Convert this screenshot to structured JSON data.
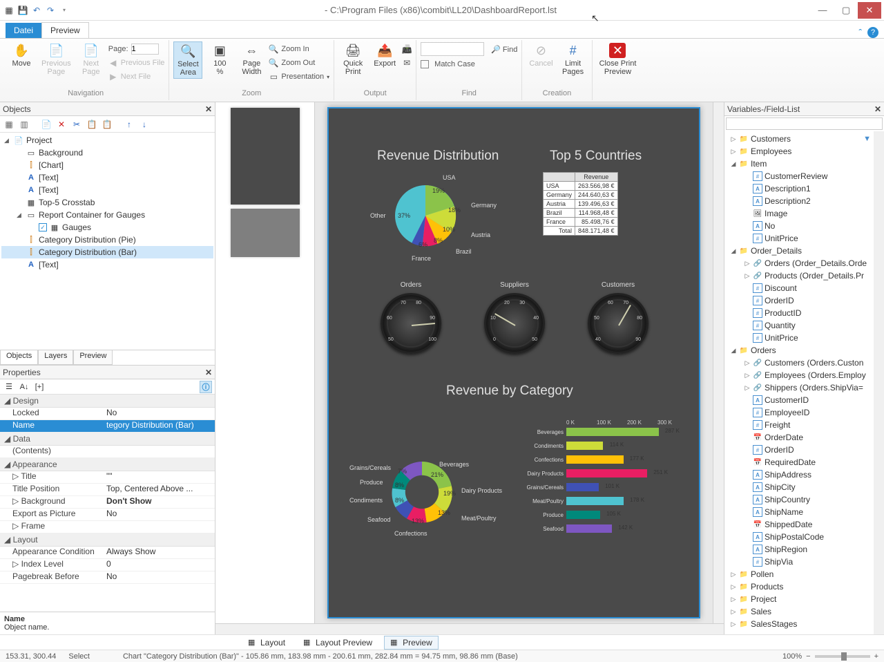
{
  "title": "- C:\\Program Files (x86)\\combit\\LL20\\DashboardReport.lst",
  "tabs": {
    "datei": "Datei",
    "preview": "Preview"
  },
  "ribbon": {
    "nav": {
      "move": "Move",
      "prevPage": "Previous\nPage",
      "nextPage": "Next\nPage",
      "page": "Page:",
      "pageVal": "1",
      "prevFile": "Previous File",
      "nextFile": "Next File",
      "group": "Navigation"
    },
    "zoom": {
      "selectArea": "Select\nArea",
      "pct": "100\n%",
      "pageWidth": "Page\nWidth",
      "zoomIn": "Zoom In",
      "zoomOut": "Zoom Out",
      "presentation": "Presentation",
      "group": "Zoom"
    },
    "output": {
      "quickPrint": "Quick\nPrint",
      "export": "Export",
      "group": "Output"
    },
    "find": {
      "find": "Find",
      "matchCase": "Match Case",
      "group": "Find"
    },
    "creation": {
      "cancel": "Cancel",
      "limitPages": "Limit\nPages",
      "group": "Creation"
    },
    "close": {
      "closePrint": "Close Print\nPreview"
    }
  },
  "objects": {
    "title": "Objects",
    "root": "Project",
    "items": [
      "Background",
      "[Chart]",
      "[Text]",
      "[Text]",
      "Top-5 Crosstab",
      "Report Container for Gauges",
      "Gauges",
      "Category Distribution (Pie)",
      "Category Distribution (Bar)",
      "[Text]"
    ],
    "tabs": [
      "Objects",
      "Layers",
      "Preview"
    ]
  },
  "props": {
    "title": "Properties",
    "cats": {
      "design": "Design",
      "data": "Data",
      "appearance": "Appearance",
      "layout": "Layout"
    },
    "rows": {
      "locked": {
        "k": "Locked",
        "v": "No"
      },
      "name": {
        "k": "Name",
        "v": "tegory Distribution (Bar)"
      },
      "contents": {
        "k": "(Contents)",
        "v": ""
      },
      "titleK": {
        "k": "Title",
        "v": "\"\""
      },
      "titlePos": {
        "k": "Title Position",
        "v": "Top, Centered Above ..."
      },
      "background": {
        "k": "Background",
        "v": "Don't Show"
      },
      "exportPic": {
        "k": "Export as Picture",
        "v": "No"
      },
      "frame": {
        "k": "Frame",
        "v": ""
      },
      "appCond": {
        "k": "Appearance Condition",
        "v": "Always Show"
      },
      "indexLevel": {
        "k": "Index Level",
        "v": "0"
      },
      "pageBreak": {
        "k": "Pagebreak Before",
        "v": "No"
      }
    },
    "footName": "Name",
    "footDesc": "Object name."
  },
  "bottomTabs": {
    "layout": "Layout",
    "layoutPreview": "Layout Preview",
    "preview": "Preview"
  },
  "vars": {
    "title": "Variables-/Field-List",
    "nodes": {
      "customers": "Customers",
      "employees": "Employees",
      "item": "Item",
      "custReview": "CustomerReview",
      "desc1": "Description1",
      "desc2": "Description2",
      "image": "Image",
      "no": "No",
      "unitPrice": "UnitPrice",
      "orderDetails": "Order_Details",
      "ordersRel": "Orders (Order_Details.Orde",
      "productsRel": "Products (Order_Details.Pr",
      "discount": "Discount",
      "orderID": "OrderID",
      "productID": "ProductID",
      "quantity": "Quantity",
      "unitPrice2": "UnitPrice",
      "orders": "Orders",
      "custRel": "Customers (Orders.Custon",
      "empRel": "Employees (Orders.Employ",
      "shipRel": "Shippers (Orders.ShipVia=",
      "customerID": "CustomerID",
      "employeeID": "EmployeeID",
      "freight": "Freight",
      "orderDate": "OrderDate",
      "orderID2": "OrderID",
      "reqDate": "RequiredDate",
      "shipAddr": "ShipAddress",
      "shipCity": "ShipCity",
      "shipCountry": "ShipCountry",
      "shipName": "ShipName",
      "shippedDate": "ShippedDate",
      "shipPostal": "ShipPostalCode",
      "shipRegion": "ShipRegion",
      "shipVia": "ShipVia",
      "pollen": "Pollen",
      "products": "Products",
      "project": "Project",
      "sales": "Sales",
      "salesStages": "SalesStages"
    }
  },
  "status": {
    "coords": "153.31, 300.44",
    "mode": "Select",
    "detail": "Chart \"Category Distribution (Bar)\"  -  105.86 mm, 183.98 mm  -   200.61 mm, 282.84 mm  =   94.75 mm,  98.86 mm (Base)",
    "zoom": "100%"
  },
  "dashboard": {
    "revDist": "Revenue Distribution",
    "top5": "Top 5 Countries",
    "revCat": "Revenue by Category",
    "gauges": {
      "orders": "Orders",
      "suppliers": "Suppliers",
      "customers": "Customers"
    },
    "table": {
      "hdr": "Revenue",
      "rows": [
        {
          "c": "USA",
          "v": "263.566,98 €"
        },
        {
          "c": "Germany",
          "v": "244.640,63 €"
        },
        {
          "c": "Austria",
          "v": "139.496,63 €"
        },
        {
          "c": "Brazil",
          "v": "114.968,48 €"
        },
        {
          "c": "France",
          "v": "85.498,76 €"
        },
        {
          "c": "Total",
          "v": "848.171,48 €"
        }
      ]
    }
  },
  "chart_data": [
    {
      "type": "pie",
      "title": "Revenue Distribution",
      "series": [
        {
          "name": "USA",
          "value": 19,
          "color": "#8bc34a"
        },
        {
          "name": "Germany",
          "value": 18,
          "color": "#cddc39"
        },
        {
          "name": "Austria",
          "value": 10,
          "color": "#ffc107"
        },
        {
          "name": "Brazil",
          "value": 8,
          "color": "#e91e63"
        },
        {
          "name": "France",
          "value": 6,
          "color": "#3f51b5"
        },
        {
          "name": "Other",
          "value": 37,
          "color": "#4fc3d0"
        }
      ]
    },
    {
      "type": "pie",
      "title": "Revenue by Category (donut)",
      "series": [
        {
          "name": "Beverages",
          "value": 21,
          "color": "#8bc34a"
        },
        {
          "name": "Dairy Products",
          "value": 19,
          "color": "#cddc39"
        },
        {
          "name": "Meat/Poultry",
          "value": 13,
          "color": "#ffc107"
        },
        {
          "name": "Confections",
          "value": 13,
          "color": "#e91e63"
        },
        {
          "name": "Seafood",
          "value": 10,
          "color": "#3f51b5"
        },
        {
          "name": "Condiments",
          "value": 8,
          "color": "#4fc3d0"
        },
        {
          "name": "Produce",
          "value": 8,
          "color": "#00897b"
        },
        {
          "name": "Grains/Cereals",
          "value": 7,
          "color": "#7e57c2"
        }
      ]
    },
    {
      "type": "bar",
      "title": "Revenue by Category",
      "xlabel": "",
      "ylabel": "",
      "xlim": [
        0,
        300
      ],
      "axis_ticks": [
        "0 K",
        "100 K",
        "200 K",
        "300 K"
      ],
      "categories": [
        "Beverages",
        "Condiments",
        "Confections",
        "Dairy Products",
        "Grains/Cereals",
        "Meat/Poultry",
        "Produce",
        "Seafood"
      ],
      "values": [
        287,
        114,
        177,
        251,
        101,
        178,
        105,
        142
      ],
      "value_labels": [
        "287 K",
        "114 K",
        "177 K",
        "251 K",
        "101 K",
        "178 K",
        "105 K",
        "142 K"
      ],
      "colors": [
        "#8bc34a",
        "#cddc39",
        "#ffc107",
        "#e91e63",
        "#3f51b5",
        "#4fc3d0",
        "#00897b",
        "#7e57c2"
      ]
    }
  ]
}
